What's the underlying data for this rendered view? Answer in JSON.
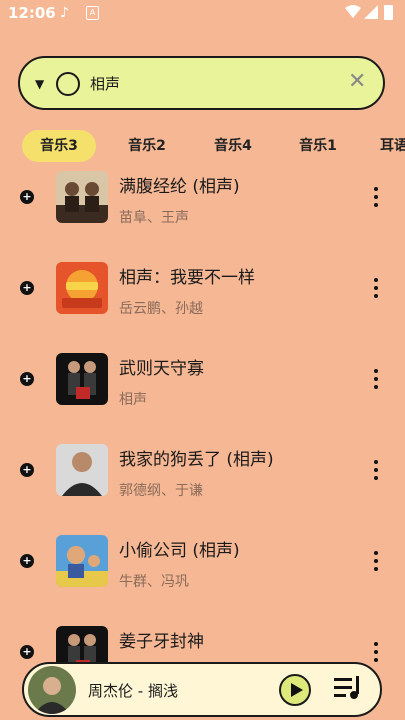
{
  "status_bar": {
    "time": "12:06"
  },
  "search": {
    "value": "相声"
  },
  "tabs": [
    {
      "label": "音乐3",
      "active": true
    },
    {
      "label": "音乐2",
      "active": false
    },
    {
      "label": "音乐4",
      "active": false
    },
    {
      "label": "音乐1",
      "active": false
    },
    {
      "label": "耳语",
      "active": false
    }
  ],
  "songs": [
    {
      "title": "满腹经纶 (相声)",
      "artist": "苗阜、王声"
    },
    {
      "title": "相声：我要不一样",
      "artist": "岳云鹏、孙越"
    },
    {
      "title": "武则天守寡",
      "artist": "相声"
    },
    {
      "title": "我家的狗丢了 (相声)",
      "artist": "郭德纲、于谦"
    },
    {
      "title": "小偷公司 (相声)",
      "artist": "牛群、冯巩"
    },
    {
      "title": "姜子牙封神",
      "artist": ""
    }
  ],
  "player": {
    "title": "周杰伦 - 搁浅"
  },
  "colors": {
    "background": "#f6b894",
    "search_bg": "#e9f49a",
    "active_tab": "#f4e06a",
    "player_bg": "#fff6d6"
  }
}
